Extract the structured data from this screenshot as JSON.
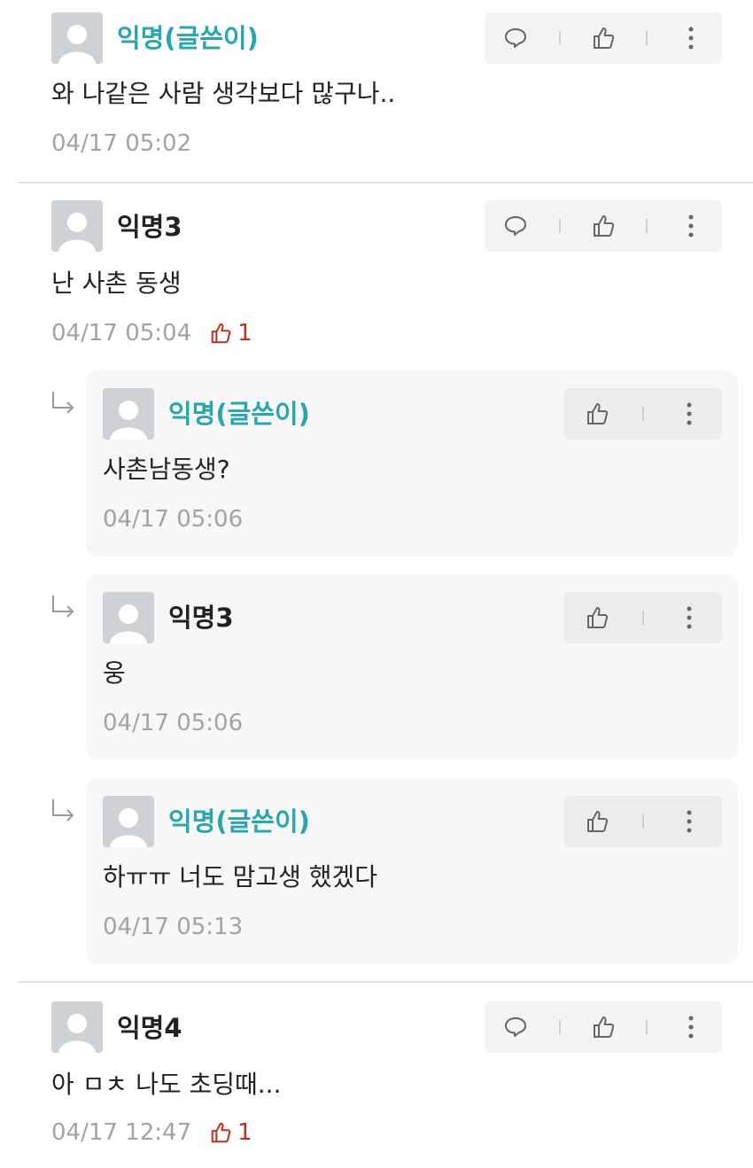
{
  "comments": [
    {
      "nickname": "익명(글쓴이)",
      "author": true,
      "text": "와 나같은 사람 생각보다 많구나..",
      "time": "04/17 05:02",
      "votes": null
    },
    {
      "nickname": "익명3",
      "author": false,
      "text": "난 사촌 동생",
      "time": "04/17 05:04",
      "votes": "1",
      "replies": [
        {
          "nickname": "익명(글쓴이)",
          "author": true,
          "text": "사촌남동생?",
          "time": "04/17 05:06"
        },
        {
          "nickname": "익명3",
          "author": false,
          "text": "웅",
          "time": "04/17 05:06"
        },
        {
          "nickname": "익명(글쓴이)",
          "author": true,
          "text": "하ㅠㅠ 너도 맘고생 했겠다",
          "time": "04/17 05:13"
        }
      ]
    },
    {
      "nickname": "익명4",
      "author": false,
      "text": "아 ㅁㅊ 나도 초딩때...",
      "time": "04/17 12:47",
      "votes": "1"
    }
  ],
  "colors": {
    "author_nick": "#2aa6ad",
    "vote": "#c62d20",
    "meta": "#a3a3a3",
    "reply_bg": "#f7f7f7"
  },
  "icons": {
    "reply": "speech-bubble-icon",
    "like": "thumbs-up-icon",
    "more": "vertical-dots-icon",
    "reply_marker": "reply-arrow-icon"
  }
}
